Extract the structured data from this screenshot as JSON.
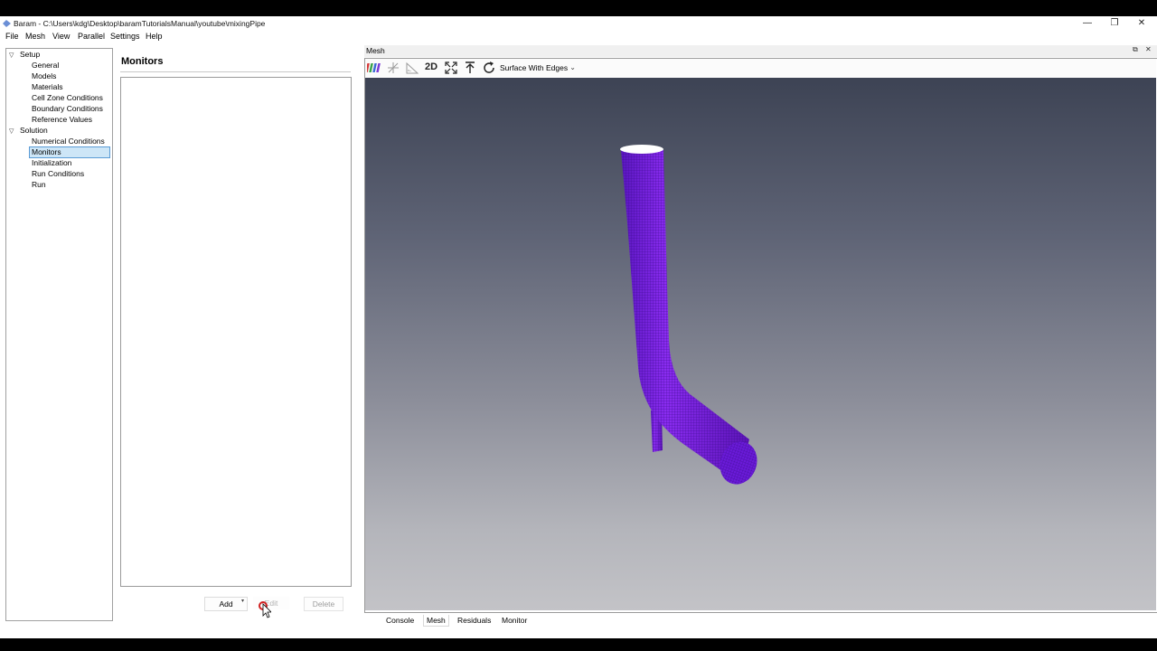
{
  "window": {
    "title": "Baram - C:\\Users\\kdg\\Desktop\\baramTutorialsManual\\youtube\\mixingPipe",
    "minimize_glyph": "—",
    "restore_glyph": "❐",
    "close_glyph": "✕"
  },
  "menu": [
    "File",
    "Mesh",
    "View",
    "Parallel",
    "Settings",
    "Help"
  ],
  "tree": {
    "groups": [
      {
        "label": "Setup",
        "expand_glyph": "▽",
        "items": [
          "General",
          "Models",
          "Materials",
          "Cell Zone Conditions",
          "Boundary Conditions",
          "Reference Values"
        ]
      },
      {
        "label": "Solution",
        "expand_glyph": "▽",
        "items": [
          "Numerical Conditions",
          "Monitors",
          "Initialization",
          "Run Conditions",
          "Run"
        ]
      }
    ],
    "selected": "Monitors"
  },
  "panel": {
    "title": "Monitors",
    "buttons": {
      "add": "Add",
      "edit": "Edit",
      "delete": "Delete"
    },
    "add_menu_glyph": "▾"
  },
  "mesh_view": {
    "dock_title": "Mesh",
    "float_glyph": "⧉",
    "close_glyph": "✕",
    "toolbar": {
      "icons": [
        "axis-color-icon",
        "axes-icon",
        "ruler-icon",
        "2d-toggle",
        "fit-view-icon",
        "view-up-icon",
        "refresh-icon"
      ],
      "label_2d": "2D",
      "render_mode": "Surface With Edges",
      "render_mode_chevron": "⌄"
    },
    "colors": {
      "pipe": "#7a1fe0",
      "pipe_shade": "#4e12a8",
      "background_top": "#3d4354",
      "background_bottom": "#c3c3c7"
    }
  },
  "bottom_tabs": {
    "items": [
      "Console",
      "Mesh",
      "Residuals",
      "Monitor"
    ],
    "active": "Mesh"
  }
}
